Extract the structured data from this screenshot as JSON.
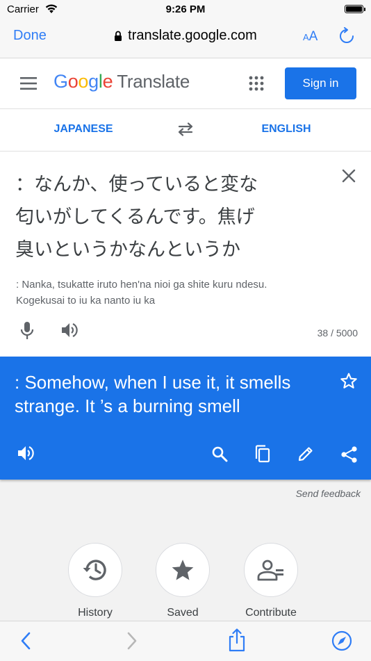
{
  "status_bar": {
    "carrier": "Carrier",
    "time": "9:26 PM"
  },
  "safari": {
    "done_label": "Done",
    "url": "translate.google.com",
    "text_size_small": "A",
    "text_size_big": "A"
  },
  "header": {
    "logo": {
      "letters": [
        "G",
        "o",
        "o",
        "g",
        "l",
        "e"
      ],
      "product": "Translate"
    },
    "sign_in_label": "Sign in"
  },
  "languages": {
    "source": "JAPANESE",
    "target": "ENGLISH"
  },
  "source": {
    "lines": [
      "：なんか、使っていると変な",
      "匂いがしてくるんです。焦げ",
      "臭いというかなんというか"
    ],
    "romanization_lines": [
      ": Nanka, tsukatte iruto hen'na nioi ga shite kuru ndesu.",
      "Kogekusai to iu ka nanto iu ka"
    ],
    "char_count": "38 / 5000"
  },
  "result": {
    "lines": [
      ": Somehow, when I use it, it smells",
      "strange. It ’s a burning smell"
    ]
  },
  "feedback_label": "Send feedback",
  "actions": [
    {
      "label": "History",
      "icon": "history-icon"
    },
    {
      "label": "Saved",
      "icon": "star-icon"
    },
    {
      "label": "Contribute",
      "icon": "contribute-icon"
    }
  ],
  "colors": {
    "accent": "#1a73e8",
    "safari_blue": "#2f7df6"
  }
}
